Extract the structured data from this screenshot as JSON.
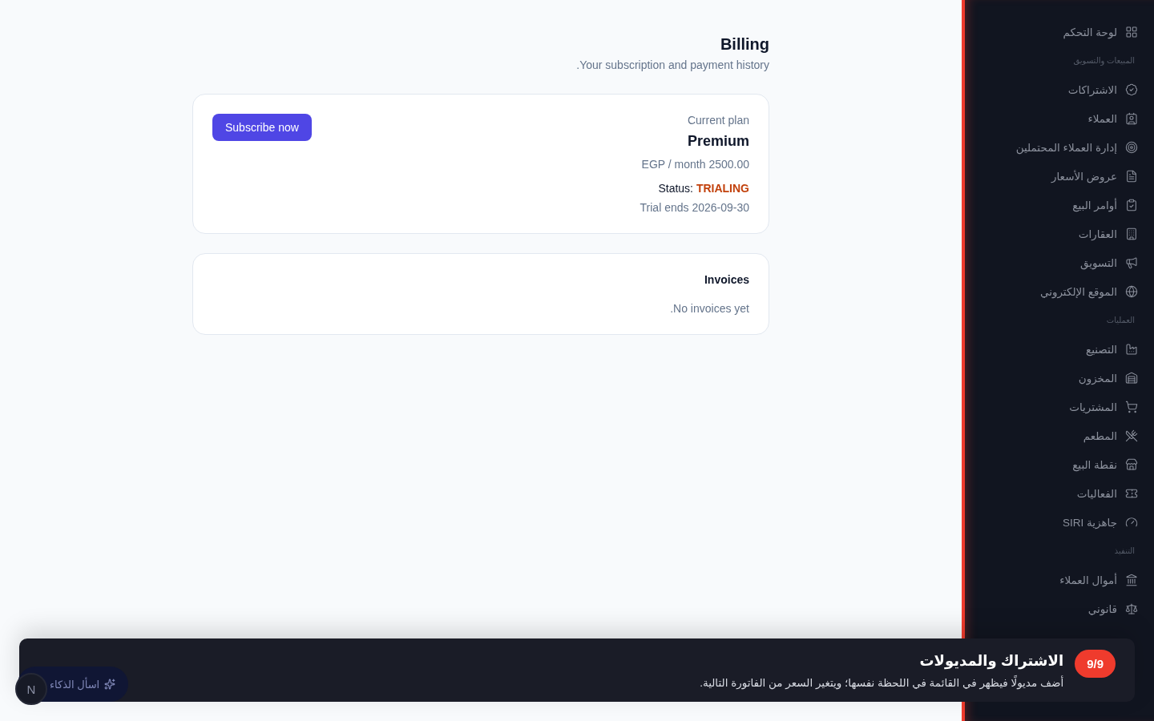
{
  "page": {
    "title": "Billing",
    "subtitle": ".Your subscription and payment history"
  },
  "plan_card": {
    "label": "Current plan",
    "plan": "Premium",
    "price": "EGP / month 2500.00",
    "status_label": "Status:",
    "status": "TRIALING",
    "trial": "Trial ends 2026-09-30",
    "button": "Subscribe now"
  },
  "invoices_card": {
    "title": "Invoices",
    "empty": ".No invoices yet"
  },
  "sidebar": {
    "items": [
      {
        "kind": "link",
        "label": "لوحة التحكم"
      },
      {
        "kind": "heading",
        "label": "المبيعات والتسويق"
      },
      {
        "kind": "link",
        "label": "الاشتراكات"
      },
      {
        "kind": "link",
        "label": "العملاء"
      },
      {
        "kind": "link",
        "label": "إدارة العملاء المحتملين"
      },
      {
        "kind": "link",
        "label": "عروض الأسعار"
      },
      {
        "kind": "link",
        "label": "أوامر البيع"
      },
      {
        "kind": "link",
        "label": "العقارات"
      },
      {
        "kind": "link",
        "label": "التسويق"
      },
      {
        "kind": "link",
        "label": "الموقع الإلكتروني"
      },
      {
        "kind": "heading",
        "label": "العمليات"
      },
      {
        "kind": "link",
        "label": "التصنيع"
      },
      {
        "kind": "link",
        "label": "المخزون"
      },
      {
        "kind": "link",
        "label": "المشتريات"
      },
      {
        "kind": "link",
        "label": "المطعم"
      },
      {
        "kind": "link",
        "label": "نقطة البيع"
      },
      {
        "kind": "link",
        "label": "الفعاليات"
      },
      {
        "kind": "link",
        "label": "جاهزية SIRI"
      },
      {
        "kind": "heading",
        "label": "التنفيذ"
      },
      {
        "kind": "link",
        "label": "أموال العملاء"
      },
      {
        "kind": "link",
        "label": "قانوني"
      }
    ]
  },
  "assistant": {
    "label": "اسأل الذكاء",
    "avatar": "N"
  },
  "tour": {
    "step": "9/9",
    "title": "الاشتراك والمديولات",
    "text": "أضف مديولًا فيظهر في القائمة في اللحظة نفسها؛ ويتغير السعر من الفاتورة التالية."
  }
}
